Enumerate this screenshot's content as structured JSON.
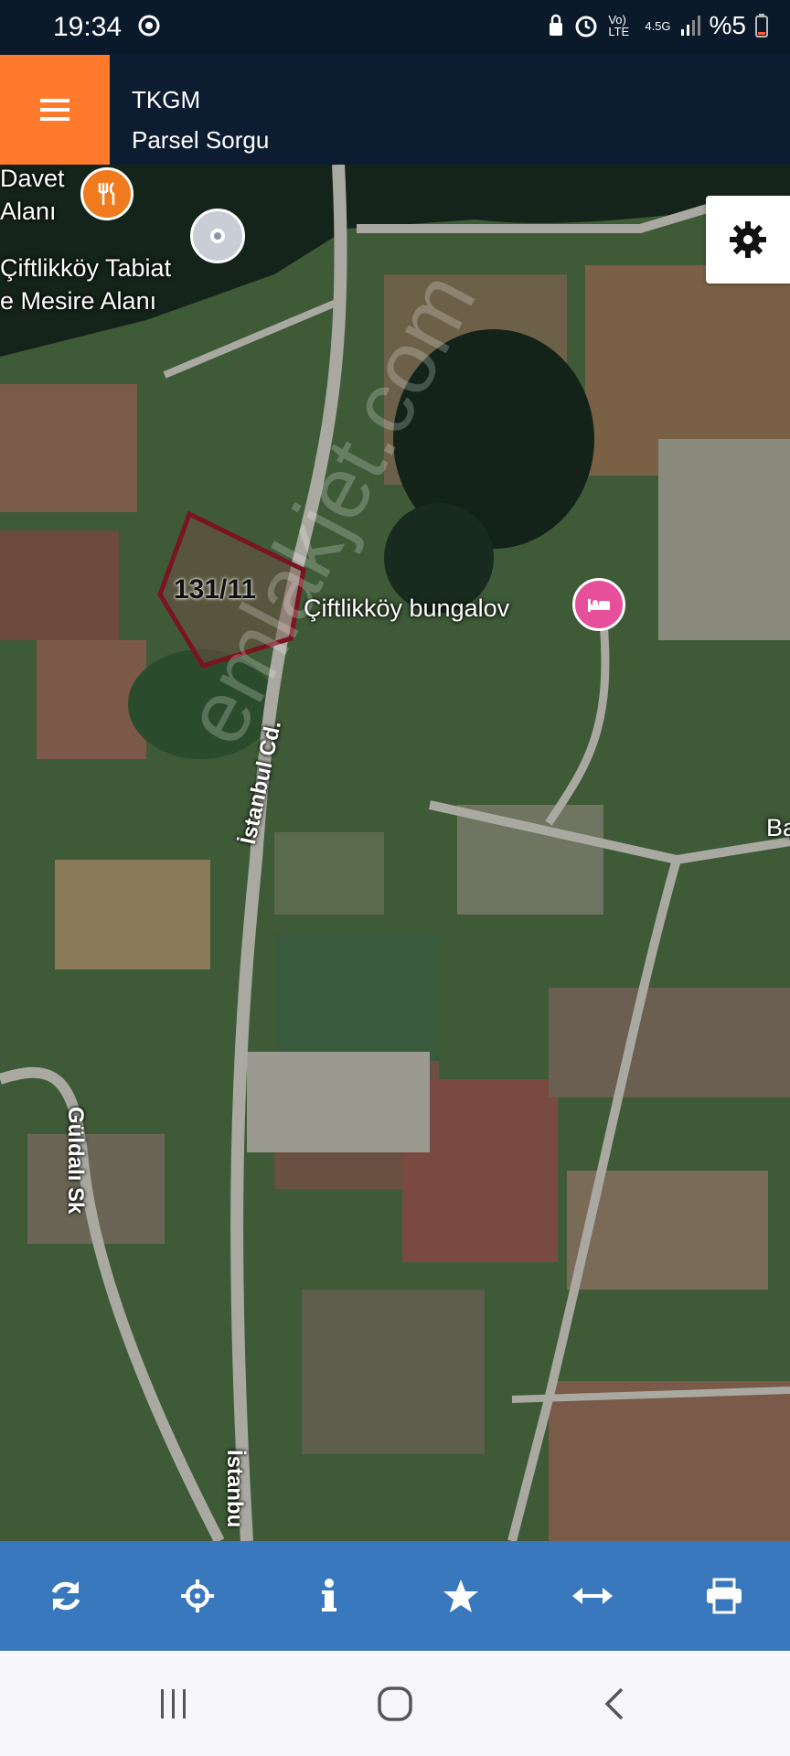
{
  "status_bar": {
    "time": "19:34",
    "network": "Vo) LTE",
    "signal": "4.5G",
    "battery": "%5"
  },
  "app_bar": {
    "title": "TKGM",
    "subtitle": "Parsel Sorgu"
  },
  "map": {
    "poi_labels": {
      "davet_line1": "Davet",
      "davet_line2": "Alanı",
      "tabiat_line1": "Çiftlikköy Tabiat",
      "tabiat_line2": "e Mesire Alanı",
      "bungalov": "Çiftlikköy bungalov",
      "ba": "Ba"
    },
    "road_labels": {
      "istanbul_cd": "İstanbul Cd.",
      "istanbul_cd_2": "İstanbu",
      "guldali_sk": "Güldalı Sk"
    },
    "parcel_label": "131/11",
    "watermark": "emlakjet.com",
    "icons": [
      "restaurant-icon",
      "location-icon",
      "hotel-icon"
    ]
  },
  "bottom_toolbar": {
    "icons": [
      "refresh-icon",
      "crosshair-icon",
      "info-icon",
      "star-icon",
      "measure-icon",
      "print-icon"
    ]
  },
  "colors": {
    "menu_button": "#ff7a2c",
    "app_bar": "#0d1d31",
    "toolbar": "#3a78bd",
    "parcel_outline": "#7a1420"
  }
}
